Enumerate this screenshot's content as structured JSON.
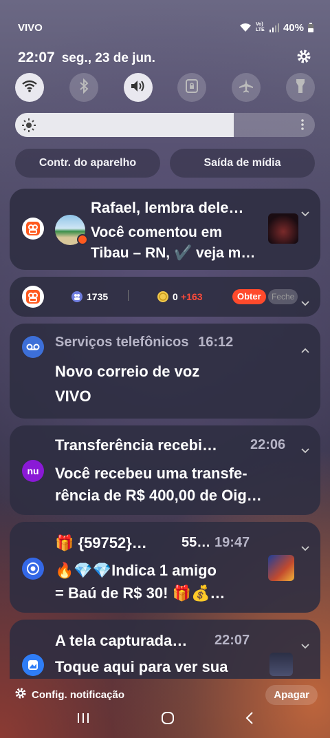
{
  "status": {
    "carrier": "VIVO",
    "battery": "40%",
    "volte": "Vo) LTE"
  },
  "header": {
    "time": "22:07",
    "date": "seg., 23 de jun."
  },
  "quick_settings": [
    "wifi-icon",
    "bluetooth-icon",
    "sound-icon",
    "rotation-lock-icon",
    "airplane-icon",
    "flashlight-icon"
  ],
  "brightness_level": 0.73,
  "pills": {
    "device_control": "Contr. do aparelho",
    "media_output": "Saída de mídia"
  },
  "notifications": {
    "kwai_comment": {
      "title": "Rafael, lembra dele…",
      "line1": "Você comentou em",
      "line2": "Tibau – RN, ✔️ veja m…"
    },
    "kwai_bar": {
      "count": "1735",
      "coins": "0",
      "bonus": "+163",
      "get_label": "Obter",
      "close_label": "Feche"
    },
    "voicemail": {
      "app": "Serviços telefônicos",
      "time": "16:12",
      "line1": "Novo correio de voz",
      "line2": "VIVO"
    },
    "nubank": {
      "title": "Transferência recebi…",
      "time": "22:06",
      "line1": "Você recebeu uma transfe-",
      "line2": "rência de R$ 400,00 de Oig…",
      "icon_text": "nu"
    },
    "chrome": {
      "title": "🎁 {59752}…",
      "sub": "55…",
      "time": "19:47",
      "line1": "🔥💎💎Indica 1 amigo",
      "line2": "= Baú de R$ 30! 🎁💰…"
    },
    "screenshot": {
      "title": "A tela capturada…",
      "time": "22:07",
      "line1": "Toque aqui para ver sua"
    }
  },
  "footer": {
    "settings_label": "Config. notificação",
    "clear_label": "Apagar"
  },
  "colors": {
    "kwai": "#ff5a1f",
    "nubank": "#8a19d6",
    "voicemail": "#3d6fd8",
    "gallery": "#2f7df6",
    "accent_red": "#ff4a3a"
  }
}
